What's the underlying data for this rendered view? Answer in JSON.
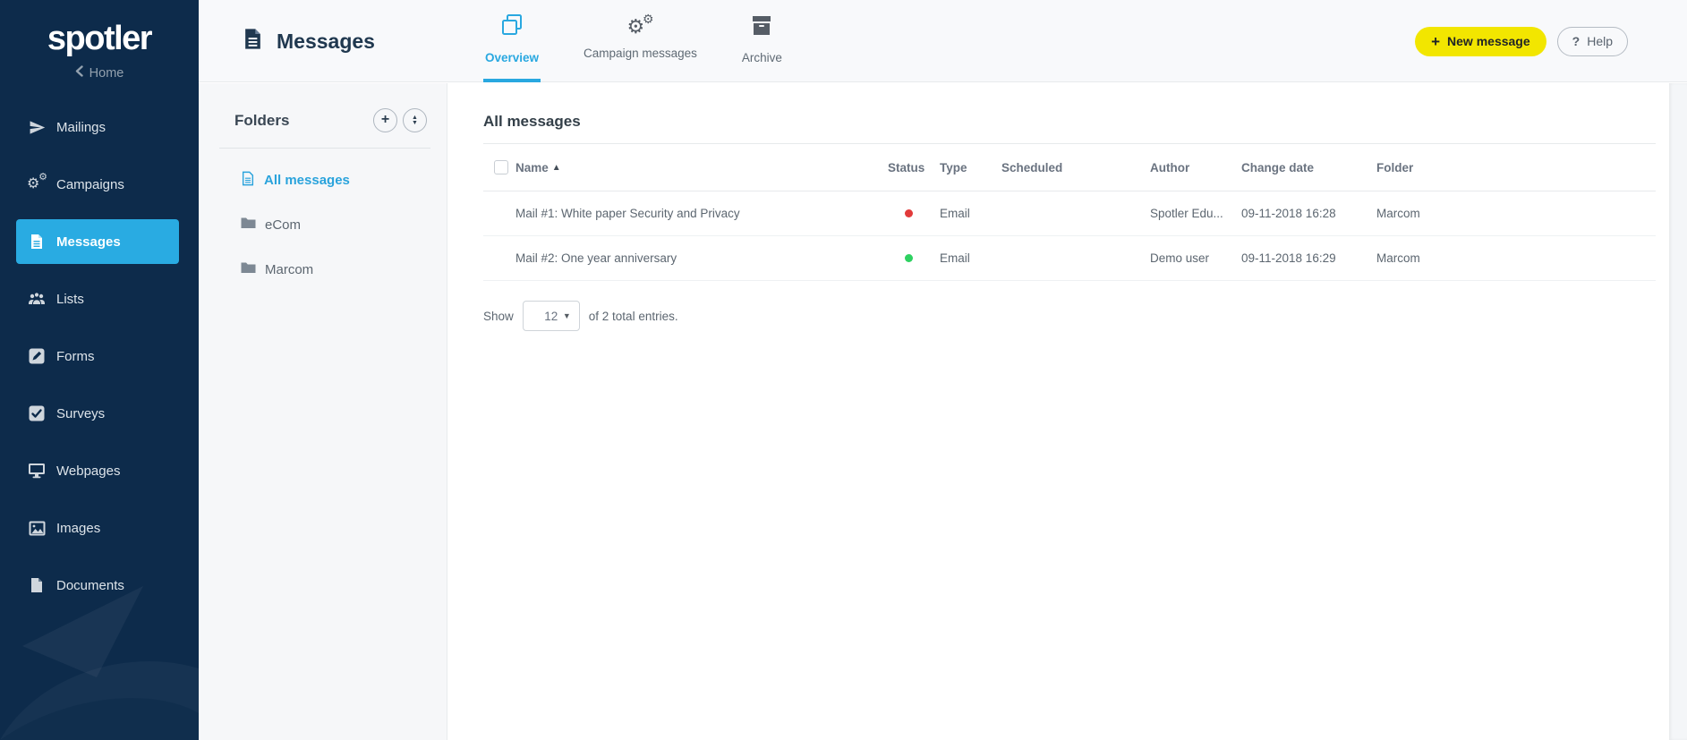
{
  "sidebar": {
    "logo": "spotler",
    "home_label": "Home",
    "items": [
      {
        "label": "Mailings",
        "icon": "paper-plane-icon"
      },
      {
        "label": "Campaigns",
        "icon": "gears-icon"
      },
      {
        "label": "Messages",
        "icon": "file-text-icon",
        "active": true
      },
      {
        "label": "Lists",
        "icon": "users-icon"
      },
      {
        "label": "Forms",
        "icon": "pencil-square-icon"
      },
      {
        "label": "Surveys",
        "icon": "check-square-icon"
      },
      {
        "label": "Webpages",
        "icon": "monitor-icon"
      },
      {
        "label": "Images",
        "icon": "image-icon"
      },
      {
        "label": "Documents",
        "icon": "file-icon"
      }
    ]
  },
  "header": {
    "title": "Messages",
    "tabs": [
      {
        "label": "Overview",
        "icon": "copy-icon",
        "active": true
      },
      {
        "label": "Campaign messages",
        "icon": "gears-icon",
        "active": false
      },
      {
        "label": "Archive",
        "icon": "archive-box-icon",
        "active": false
      }
    ],
    "new_message_label": "New message",
    "help_label": "Help"
  },
  "folders": {
    "title": "Folders",
    "items": [
      {
        "label": "All messages",
        "icon": "file-text-icon",
        "active": true
      },
      {
        "label": "eCom",
        "icon": "folder-icon",
        "active": false
      },
      {
        "label": "Marcom",
        "icon": "folder-icon",
        "active": false
      }
    ]
  },
  "table": {
    "section_title": "All messages",
    "columns": {
      "name": "Name",
      "status": "Status",
      "type": "Type",
      "scheduled": "Scheduled",
      "author": "Author",
      "change_date": "Change date",
      "folder": "Folder"
    },
    "sort": {
      "column": "Name",
      "direction": "asc"
    },
    "rows": [
      {
        "name": "Mail #1: White paper Security and Privacy",
        "status": "red",
        "type": "Email",
        "scheduled": "",
        "author": "Spotler Edu...",
        "change_date": "09-11-2018 16:28",
        "folder": "Marcom"
      },
      {
        "name": "Mail #2: One year anniversary",
        "status": "green",
        "type": "Email",
        "scheduled": "",
        "author": "Demo user",
        "change_date": "09-11-2018 16:29",
        "folder": "Marcom"
      }
    ],
    "footer": {
      "show_label": "Show",
      "page_size": "12",
      "total_text": "of 2 total entries."
    }
  },
  "colors": {
    "sidebar_bg": "#0d2b4b",
    "active_item_bg": "#29abe2",
    "accent_blue": "#2aa3dc",
    "new_message_yellow": "#f2e600",
    "status_red": "#e23a3a",
    "status_green": "#2ed161"
  }
}
